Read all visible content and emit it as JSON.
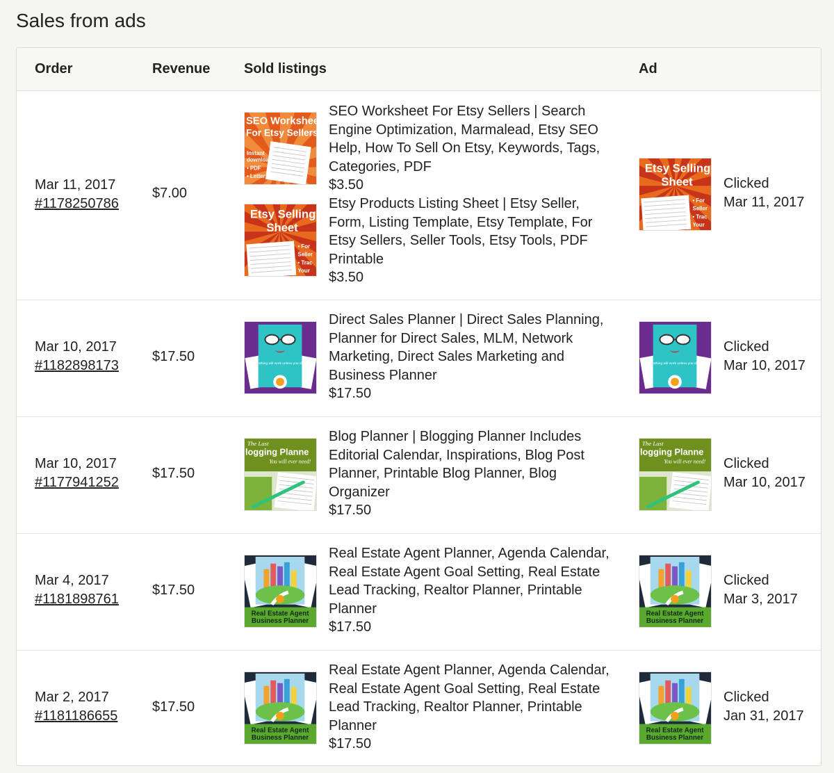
{
  "page": {
    "title": "Sales from ads"
  },
  "table": {
    "headers": {
      "order": "Order",
      "revenue": "Revenue",
      "sold_listings": "Sold listings",
      "ad": "Ad"
    },
    "rows": [
      {
        "order_date": "Mar 11, 2017",
        "order_number": "#1178250786",
        "revenue": "$7.00",
        "listings": [
          {
            "thumb": "seo-worksheet",
            "title": "SEO Worksheet For Etsy Sellers | Search Engine Optimization, Marmalead, Etsy SEO Help, How To Sell On Etsy, Keywords, Tags, Categories, PDF",
            "price": "$3.50"
          },
          {
            "thumb": "etsy-selling-sheet",
            "title": "Etsy Products Listing Sheet | Etsy Seller, Form, Listing Template, Etsy Template, For Etsy Sellers, Seller Tools, Etsy Tools, PDF Printable",
            "price": "$3.50"
          }
        ],
        "ad": {
          "thumb": "etsy-selling-sheet",
          "status": "Clicked",
          "date": "Mar 11, 2017"
        }
      },
      {
        "order_date": "Mar 10, 2017",
        "order_number": "#1182898173",
        "revenue": "$17.50",
        "listings": [
          {
            "thumb": "direct-sales-planner",
            "title": "Direct Sales Planner | Direct Sales Planning, Planner for Direct Sales, MLM, Network Marketing, Direct Sales Marketing and Business Planner",
            "price": "$17.50"
          }
        ],
        "ad": {
          "thumb": "direct-sales-planner",
          "status": "Clicked",
          "date": "Mar 10, 2017"
        }
      },
      {
        "order_date": "Mar 10, 2017",
        "order_number": "#1177941252",
        "revenue": "$17.50",
        "listings": [
          {
            "thumb": "blog-planner",
            "title": "Blog Planner | Blogging Planner Includes Editorial Calendar, Inspirations, Blog Post Planner, Printable Blog Planner, Blog Organizer",
            "price": "$17.50"
          }
        ],
        "ad": {
          "thumb": "blog-planner",
          "status": "Clicked",
          "date": "Mar 10, 2017"
        }
      },
      {
        "order_date": "Mar 4, 2017",
        "order_number": "#1181898761",
        "revenue": "$17.50",
        "listings": [
          {
            "thumb": "real-estate-planner",
            "title": "Real Estate Agent Planner, Agenda Calendar, Real Estate Agent Goal Setting, Real Estate Lead Tracking, Realtor Planner, Printable Planner",
            "price": "$17.50"
          }
        ],
        "ad": {
          "thumb": "real-estate-planner",
          "status": "Clicked",
          "date": "Mar 3, 2017"
        }
      },
      {
        "order_date": "Mar 2, 2017",
        "order_number": "#1181186655",
        "revenue": "$17.50",
        "listings": [
          {
            "thumb": "real-estate-planner",
            "title": "Real Estate Agent Planner, Agenda Calendar, Real Estate Agent Goal Setting, Real Estate Lead Tracking, Realtor Planner, Printable Planner",
            "price": "$17.50"
          }
        ],
        "ad": {
          "thumb": "real-estate-planner",
          "status": "Clicked",
          "date": "Jan 31, 2017"
        }
      }
    ]
  },
  "thumb_text": {
    "seo-worksheet": {
      "line1": "SEO Workshee",
      "line2": "For Etsy Sellers",
      "bullets": "Instant download • PDF • Letter"
    },
    "etsy-selling-sheet": {
      "line1": "Etsy Selling",
      "line2": "Sheet",
      "bullets": "• For Etsy Sellers • Track Your"
    },
    "direct-sales-planner": {
      "line1": "Nothing will work unless you do."
    },
    "blog-planner": {
      "line1": "The Last",
      "line2": "logging Planne",
      "line3": "You will ever need!"
    },
    "real-estate-planner": {
      "line1": "Real Estate Agent",
      "line2": "Business Planner"
    }
  },
  "colors": {
    "seo_orange": "#e25b1c",
    "purple": "#6a2c8f",
    "teal": "#2ec4c6",
    "olive_green": "#6f8f1f",
    "dark_navy": "#1f2b3a",
    "lime_banner": "#5aa82d"
  }
}
